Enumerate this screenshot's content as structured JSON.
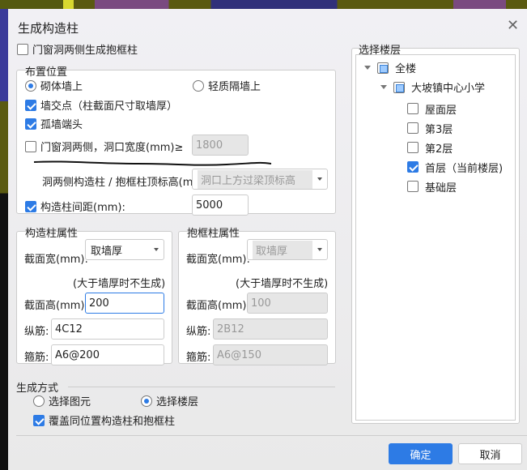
{
  "dialog": {
    "title": "生成构造柱",
    "close_icon": "close-icon"
  },
  "opening_frame": {
    "label": "门窗洞两侧生成抱框柱",
    "checked": false
  },
  "placement": {
    "label": "布置位置",
    "radio_masonry": "砌体墙上",
    "radio_masonry_selected": true,
    "radio_light": "轻质隔墙上",
    "wall_intersection": "墙交点（柱截面尺寸取墙厚）",
    "wall_intersection_checked": true,
    "isolated_wall_end": "孤墙端头",
    "isolated_wall_end_checked": true,
    "opening_sides": "门窗洞两侧，洞口宽度(mm)≥",
    "opening_sides_checked": false,
    "opening_width": "1800",
    "top_elev_label": "洞两侧构造柱 / 抱框柱顶标高(m):",
    "top_elev_value": "洞口上方过梁顶标高",
    "spacing": "构造柱间距(mm):",
    "spacing_checked": true,
    "spacing_value": "5000"
  },
  "column_props": {
    "label": "构造柱属性",
    "width_label": "截面宽(mm):",
    "width_value": "取墙厚",
    "note": "(大于墙厚时不生成)",
    "height_label": "截面高(mm):",
    "height_value": "200",
    "long_label": "纵筋:",
    "long_value": "4C12",
    "stirrup_label": "箍筋:",
    "stirrup_value": "A6@200"
  },
  "frame_props": {
    "label": "抱框柱属性",
    "width_label": "截面宽(mm):",
    "width_value": "取墙厚",
    "note": "(大于墙厚时不生成)",
    "height_label": "截面高(mm):",
    "height_value": "100",
    "long_label": "纵筋:",
    "long_value": "2B12",
    "stirrup_label": "箍筋:",
    "stirrup_value": "A6@150"
  },
  "method": {
    "label": "生成方式",
    "radio_elements": "选择图元",
    "radio_floors": "选择楼层",
    "radio_floors_selected": true,
    "overwrite": "覆盖同位置构造柱和抱框柱",
    "overwrite_checked": true
  },
  "floors": {
    "label": "选择楼层",
    "root": "全楼",
    "building": "大坡镇中心小学",
    "items": [
      {
        "label": "屋面层",
        "checked": false
      },
      {
        "label": "第3层",
        "checked": false
      },
      {
        "label": "第2层",
        "checked": false
      },
      {
        "label": "首层（当前楼层)",
        "checked": true
      },
      {
        "label": "基础层",
        "checked": false
      }
    ]
  },
  "buttons": {
    "ok": "确定",
    "cancel": "取消"
  },
  "colors": {
    "accent": "#2d7be5"
  }
}
